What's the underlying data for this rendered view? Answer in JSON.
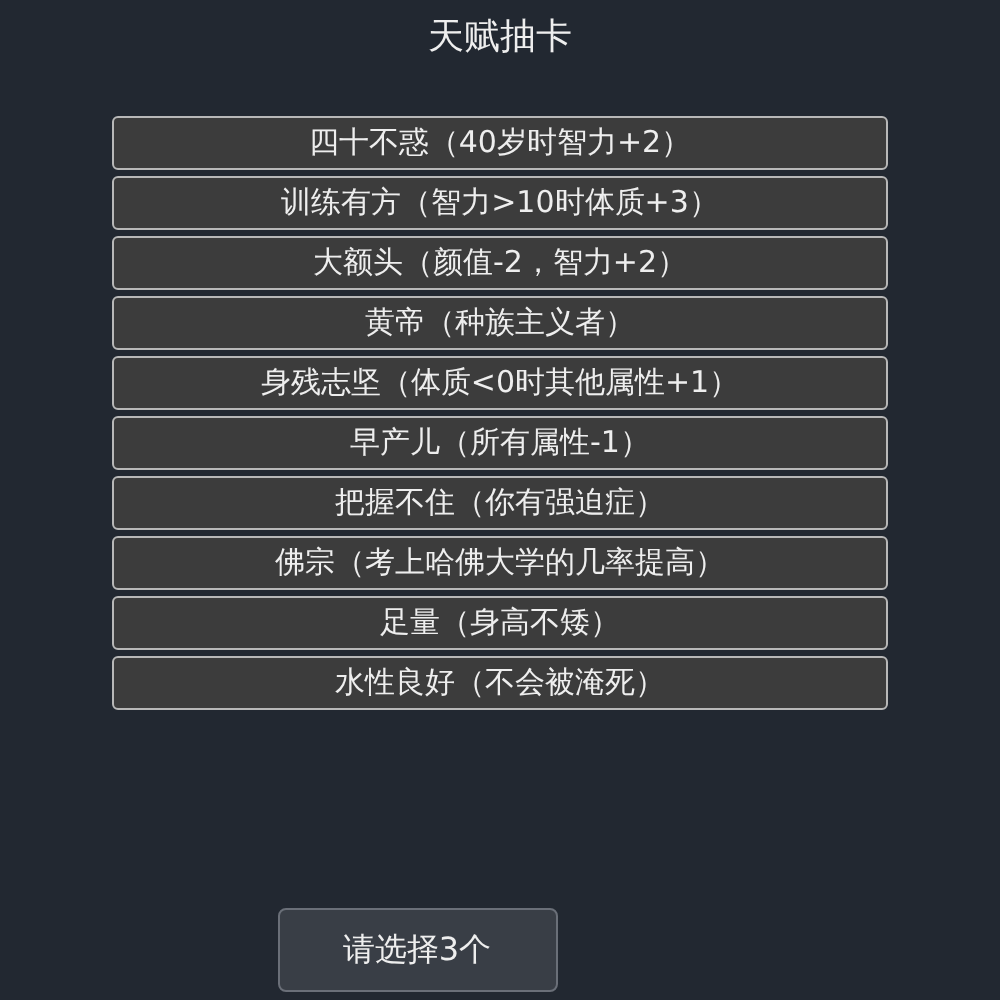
{
  "title": "天赋抽卡",
  "talents": [
    {
      "label": "四十不惑（40岁时智力+2）"
    },
    {
      "label": "训练有方（智力>10时体质+3）"
    },
    {
      "label": "大额头（颜值-2，智力+2）"
    },
    {
      "label": "黄帝（种族主义者）"
    },
    {
      "label": "身残志坚（体质<0时其他属性+1）"
    },
    {
      "label": "早产儿（所有属性-1）"
    },
    {
      "label": "把握不住（你有强迫症）"
    },
    {
      "label": "佛宗（考上哈佛大学的几率提高）"
    },
    {
      "label": "足量（身高不矮）"
    },
    {
      "label": "水性良好（不会被淹死）"
    }
  ],
  "confirm_button": "请选择3个"
}
